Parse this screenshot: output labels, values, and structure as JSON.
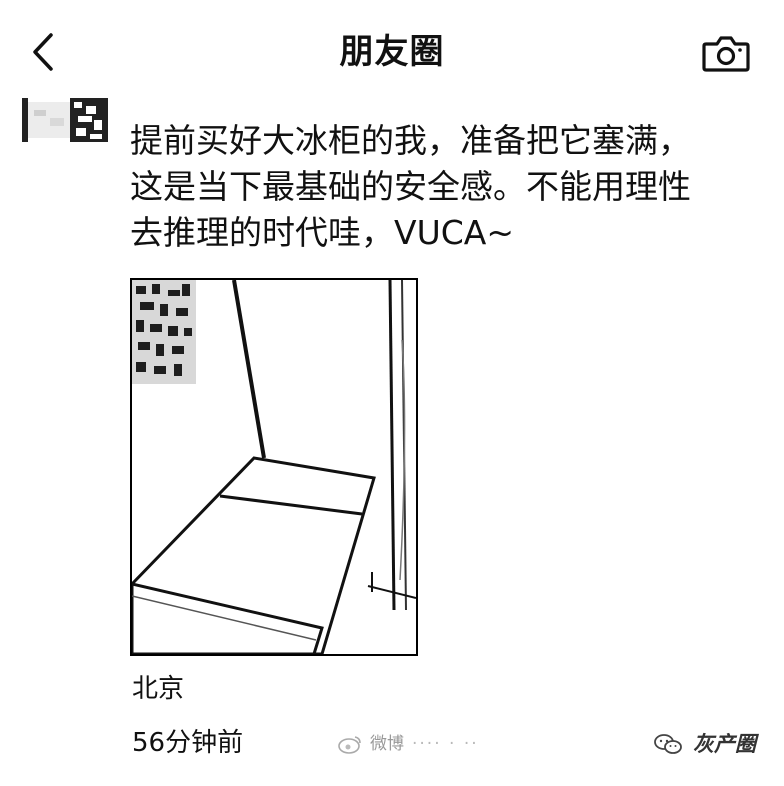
{
  "header": {
    "title": "朋友圈",
    "back_icon": "chevron-left-icon",
    "camera_icon": "camera-icon"
  },
  "post": {
    "text": "提前买好大冰柜的我，准备把它塞满，\n这是当下最基础的安全感。不能用理性\n去推理的时代哇，VUCA~",
    "location": "北京",
    "timestamp": "56分钟前"
  },
  "watermarks": {
    "platform": "微博",
    "brand": "灰产圈"
  }
}
